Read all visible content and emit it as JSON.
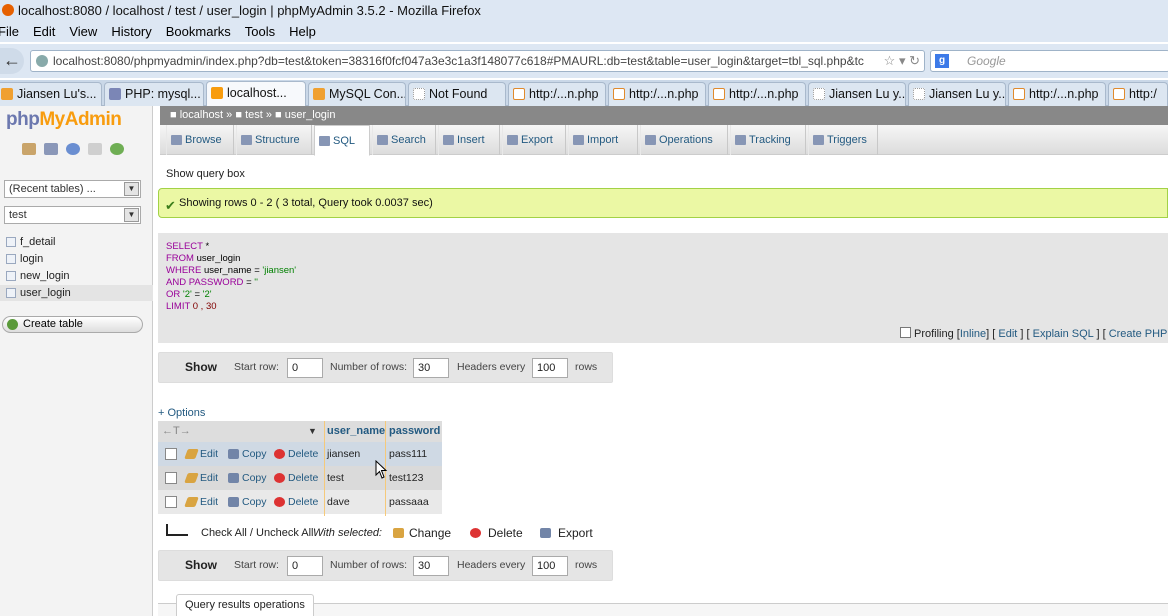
{
  "window": {
    "title": "localhost:8080 / localhost / test / user_login | phpMyAdmin 3.5.2 - Mozilla Firefox"
  },
  "menu": [
    "File",
    "Edit",
    "View",
    "History",
    "Bookmarks",
    "Tools",
    "Help"
  ],
  "address_bar": {
    "url": "localhost:8080/phpmyadmin/index.php?db=test&token=38316f0fcf047a3e3c1a3f148077c618#PMAURL:db=test&table=user_login&target=tbl_sql.php&tc",
    "search_placeholder": "Google"
  },
  "tabs": [
    {
      "label": "Jiansen Lu's...",
      "icon": "blogger-icon"
    },
    {
      "label": "PHP: mysql...",
      "icon": "php-icon"
    },
    {
      "label": "localhost...",
      "icon": "pma-icon"
    },
    {
      "label": "MySQL Con...",
      "icon": "blogger-icon"
    },
    {
      "label": "Not Found",
      "icon": "blank-page-icon"
    },
    {
      "label": "http:/...n.php",
      "icon": "xampp-icon"
    },
    {
      "label": "http:/...n.php",
      "icon": "xampp-icon"
    },
    {
      "label": "http:/...n.php",
      "icon": "xampp-icon"
    },
    {
      "label": "Jiansen Lu y...",
      "icon": "blank-page-icon"
    },
    {
      "label": "Jiansen Lu y...",
      "icon": "blank-page-icon"
    },
    {
      "label": "http:/...n.php",
      "icon": "xampp-icon"
    },
    {
      "label": "http:/",
      "icon": "xampp-icon"
    }
  ],
  "sidebar": {
    "logo_php": "php",
    "logo_myadmin": "MyAdmin",
    "recent_tables": "(Recent tables) ...",
    "database": "test",
    "tables": [
      "f_detail",
      "login",
      "new_login",
      "user_login"
    ],
    "create_table": "Create table"
  },
  "breadcrumb": {
    "server": "localhost",
    "database": "test",
    "table": "user_login"
  },
  "nav_tabs": [
    "Browse",
    "Structure",
    "SQL",
    "Search",
    "Insert",
    "Export",
    "Import",
    "Operations",
    "Tracking",
    "Triggers"
  ],
  "main": {
    "show_query_box": "Show query box",
    "success_message": "Showing rows 0 - 2 ( 3 total, Query took 0.0037 sec)",
    "sql": {
      "select": "SELECT",
      "star": "*",
      "from": "FROM",
      "table": "user_login",
      "where": "WHERE",
      "where_col": "user_name",
      "eq": "=",
      "where_val": "'jiansen'",
      "and": "AND",
      "password": "PASSWORD",
      "pw_val": "''",
      "or": "OR",
      "or_left": "'2'",
      "or_right": "'2'",
      "limit": "LIMIT",
      "limit_val": "0 , 30"
    },
    "profiling": {
      "label": "Profiling",
      "inline": "Inline",
      "edit": "Edit",
      "explain": "Explain SQL",
      "create_php": "Create PHP"
    },
    "nav": {
      "show": "Show",
      "start_row_label": "Start row:",
      "start_row": "0",
      "num_rows_label": "Number of rows:",
      "num_rows": "30",
      "headers_every_label": "Headers every",
      "headers_every": "100",
      "rows_label": "rows"
    },
    "options_link": "+ Options",
    "table": {
      "columns": [
        "user_name",
        "password"
      ],
      "actions": {
        "edit": "Edit",
        "copy": "Copy",
        "delete": "Delete"
      },
      "rows": [
        {
          "user_name": "jiansen",
          "password": "pass111"
        },
        {
          "user_name": "test",
          "password": "test123"
        },
        {
          "user_name": "dave",
          "password": "passaaa"
        }
      ]
    },
    "bulk": {
      "check_all": "Check All / Uncheck All",
      "with_selected": "With selected:",
      "change": "Change",
      "delete": "Delete",
      "export": "Export"
    },
    "query_results_ops": "Query results operations"
  }
}
